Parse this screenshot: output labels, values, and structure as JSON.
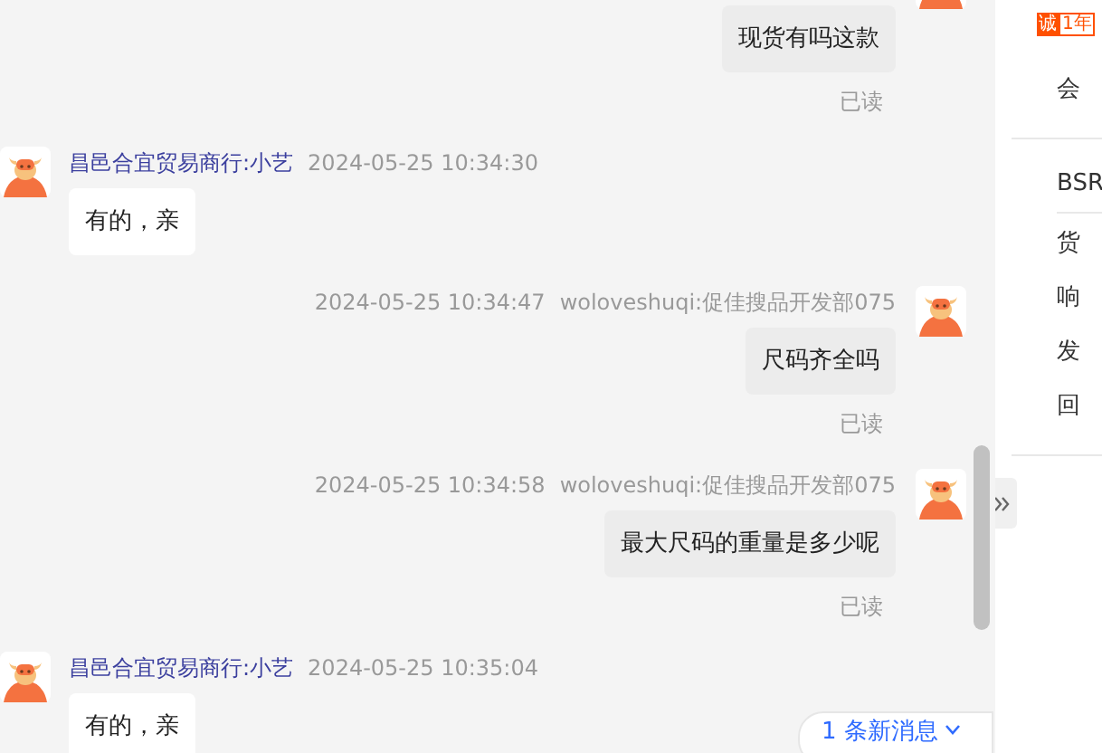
{
  "messages": [
    {
      "kind": "outgoing",
      "text": "现货有吗这款",
      "read": "已读"
    },
    {
      "kind": "incoming",
      "sender": "昌邑合宜贸易商行:小艺",
      "time": "2024-05-25 10:34:30",
      "text": "有的，亲"
    },
    {
      "kind": "outgoing",
      "sender": "woloveshuqi:促佳搜品开发部075",
      "time": "2024-05-25 10:34:47",
      "text": "尺码齐全吗",
      "read": "已读"
    },
    {
      "kind": "outgoing",
      "sender": "woloveshuqi:促佳搜品开发部075",
      "time": "2024-05-25 10:34:58",
      "text": "最大尺码的重量是多少呢",
      "read": "已读"
    },
    {
      "kind": "incoming",
      "sender": "昌邑合宜贸易商行:小艺",
      "time": "2024-05-25 10:35:04",
      "text": "有的，亲"
    }
  ],
  "new_messages": {
    "label": "1 条新消息"
  },
  "side_panel": {
    "badge": {
      "icon": "诚",
      "years": "1年"
    },
    "member": "会",
    "bsr": "BSR",
    "items": [
      "货",
      "响",
      "发",
      "回"
    ]
  }
}
